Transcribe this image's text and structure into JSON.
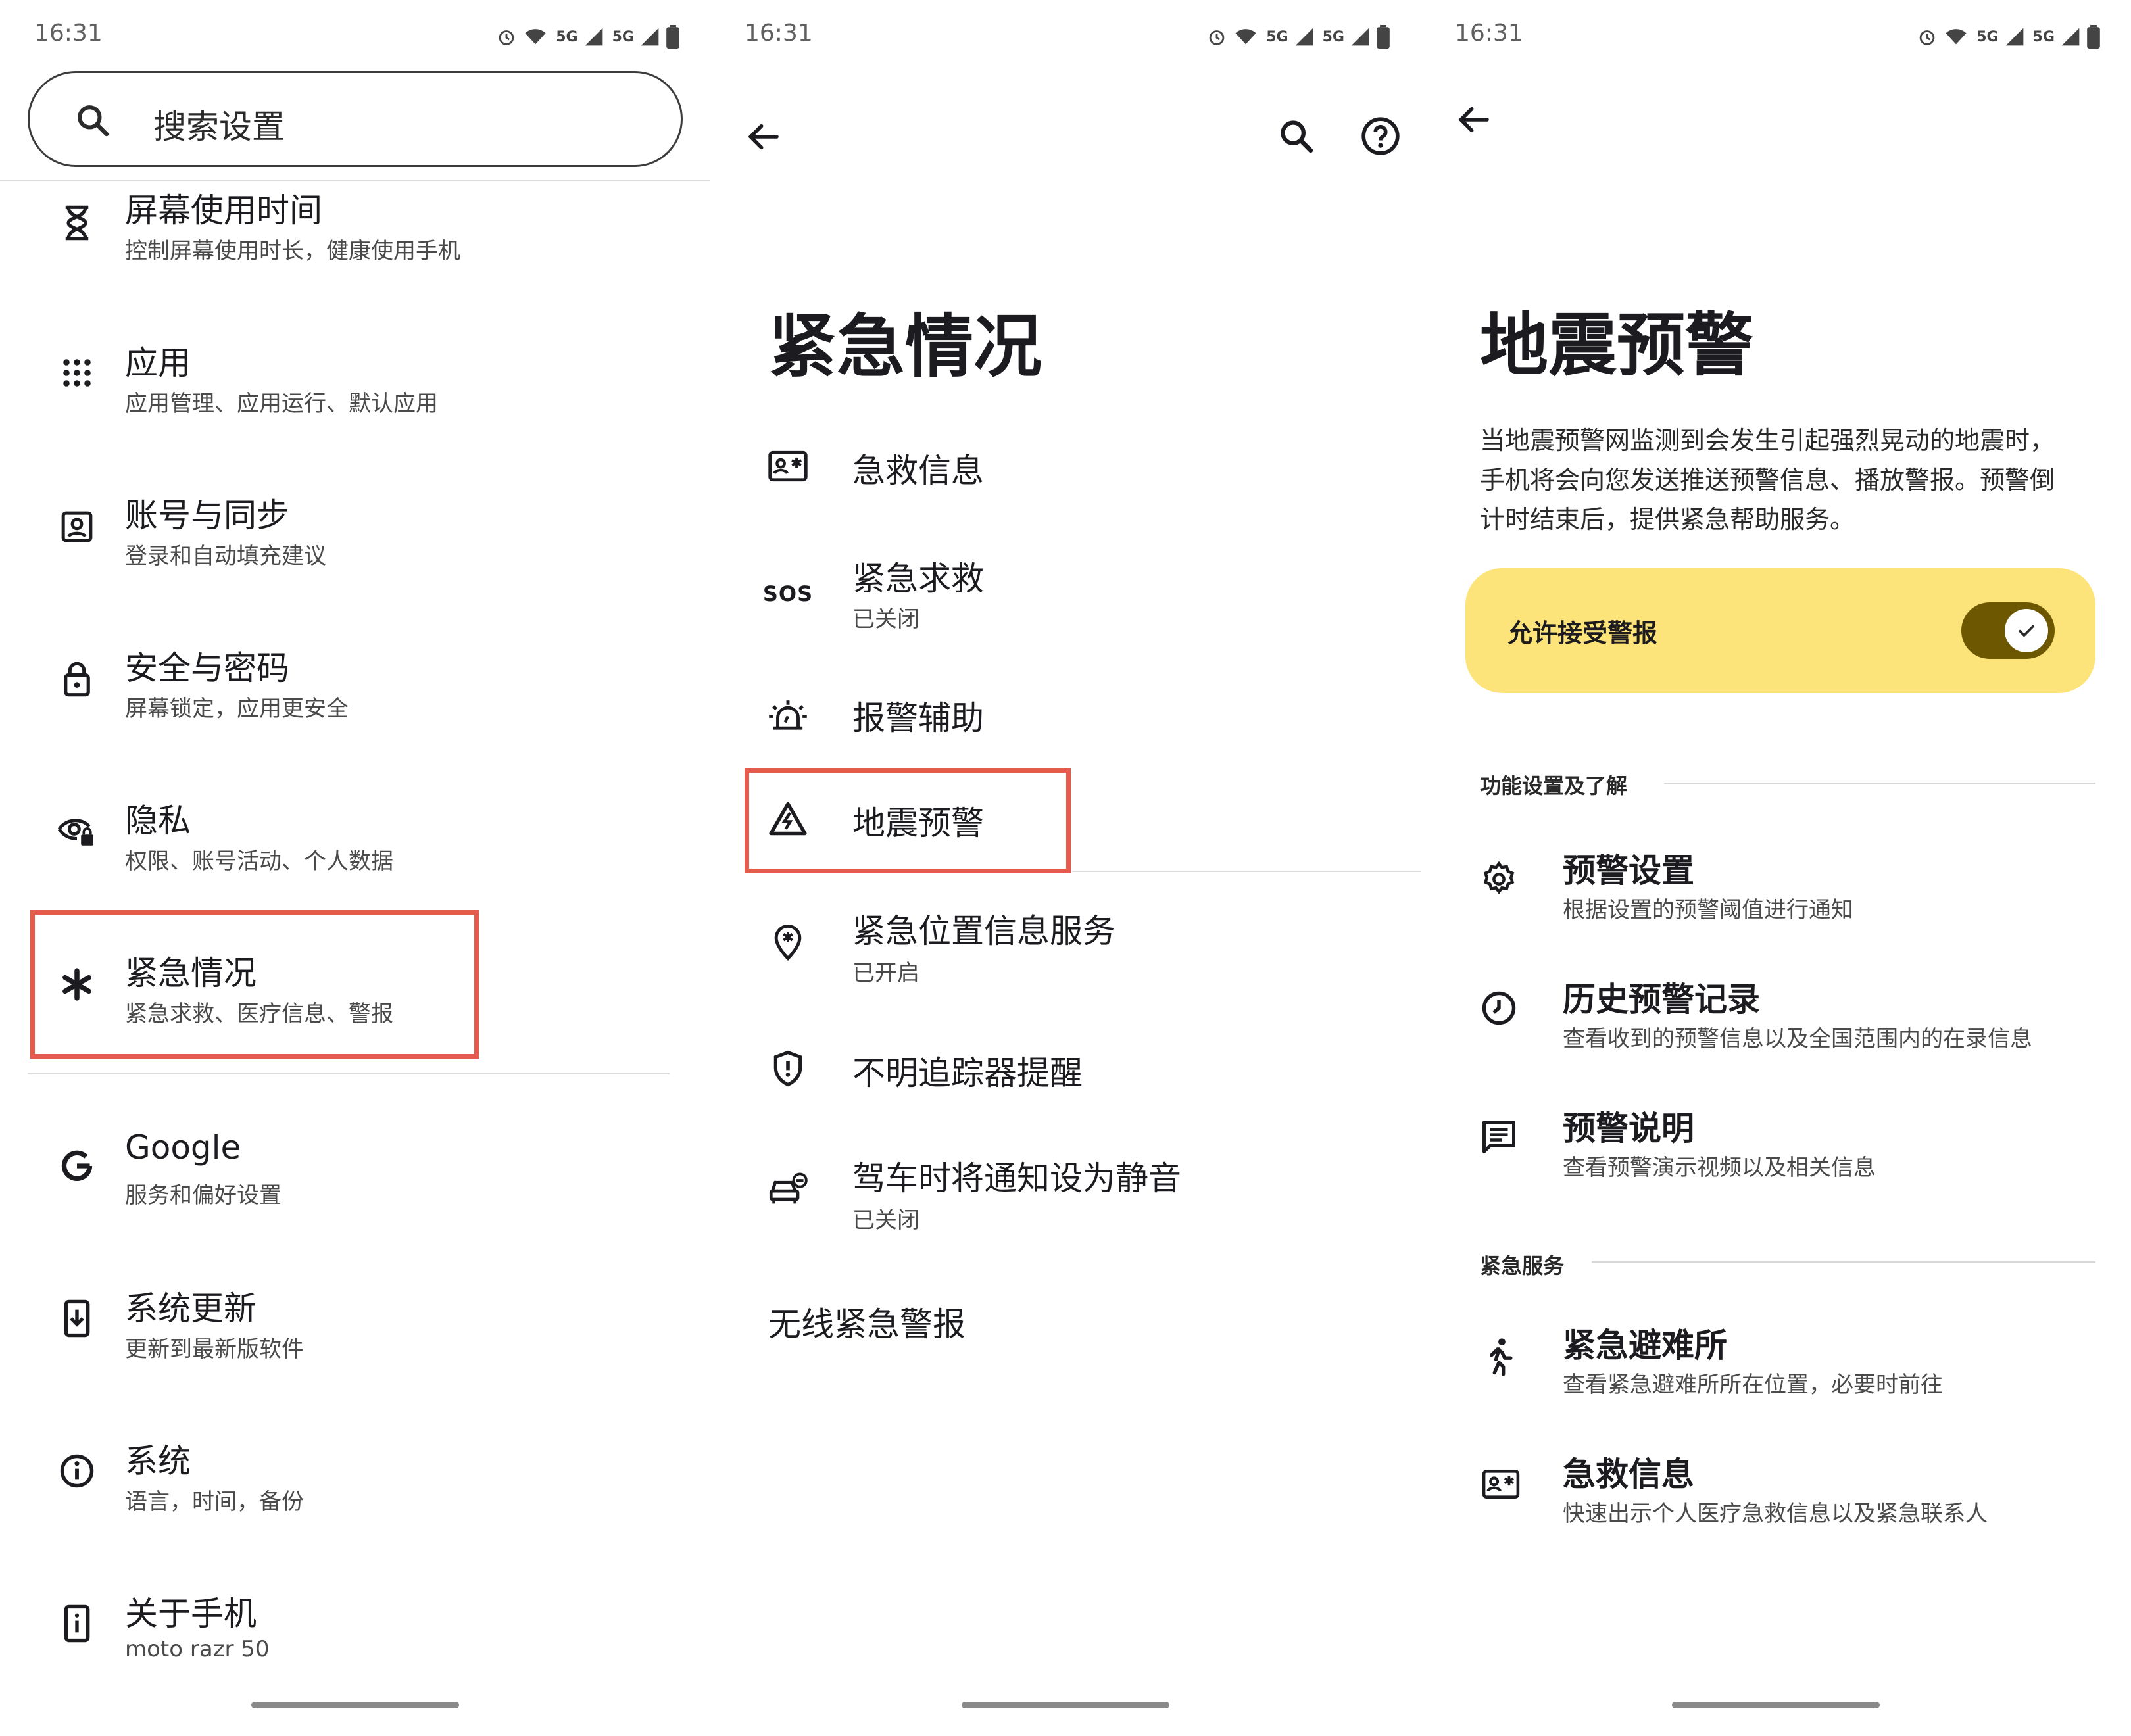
{
  "status_time": "16:31",
  "status_signal": "5G",
  "panel1": {
    "search_placeholder": "搜索设置",
    "items": [
      {
        "title": "屏幕使用时间",
        "sub": "控制屏幕使用时长，健康使用手机",
        "icon": "hourglass-icon"
      },
      {
        "title": "应用",
        "sub": "应用管理、应用运行、默认应用",
        "icon": "apps-grid-icon"
      },
      {
        "title": "账号与同步",
        "sub": "登录和自动填充建议",
        "icon": "account-box-icon"
      },
      {
        "title": "安全与密码",
        "sub": "屏幕锁定，应用更安全",
        "icon": "lock-icon"
      },
      {
        "title": "隐私",
        "sub": "权限、账号活动、个人数据",
        "icon": "privacy-eye-icon"
      },
      {
        "title": "紧急情况",
        "sub": "紧急求救、医疗信息、警报",
        "icon": "asterisk-icon"
      },
      {
        "title": "Google",
        "sub": "服务和偏好设置",
        "icon": "google-icon"
      },
      {
        "title": "系统更新",
        "sub": "更新到最新版软件",
        "icon": "system-update-icon"
      },
      {
        "title": "系统",
        "sub": "语言，时间，备份",
        "icon": "info-icon"
      },
      {
        "title": "关于手机",
        "sub": "moto razr 50",
        "icon": "phone-info-icon"
      }
    ]
  },
  "panel2": {
    "title": "紧急情况",
    "items": [
      {
        "title": "急救信息",
        "sub": "",
        "icon": "medical-id-icon"
      },
      {
        "title": "紧急求救",
        "sub": "已关闭",
        "icon": "sos-icon",
        "icon_text": "SOS"
      },
      {
        "title": "报警辅助",
        "sub": "",
        "icon": "alarm-light-icon"
      },
      {
        "title": "地震预警",
        "sub": "",
        "icon": "earthquake-warning-icon"
      },
      {
        "title": "紧急位置信息服务",
        "sub": "已开启",
        "icon": "location-icon"
      },
      {
        "title": "不明追踪器提醒",
        "sub": "",
        "icon": "shield-icon"
      },
      {
        "title": "驾车时将通知设为静音",
        "sub": "已关闭",
        "icon": "car-mute-icon"
      }
    ],
    "wireless_alerts": "无线紧急警报"
  },
  "panel3": {
    "title": "地震预警",
    "description": "当地震预警网监测到会发生引起强烈晃动的地震时，手机将会向您发送推送预警信息、播放警报。预警倒计时结束后，提供紧急帮助服务。",
    "toggle_label": "允许接受警报",
    "toggle_on": true,
    "section1": "功能设置及了解",
    "items1": [
      {
        "title": "预警设置",
        "sub": "根据设置的预警阈值进行通知",
        "icon": "gear-icon"
      },
      {
        "title": "历史预警记录",
        "sub": "查看收到的预警信息以及全国范围内的在录信息",
        "icon": "clock-icon"
      },
      {
        "title": "预警说明",
        "sub": "查看预警演示视频以及相关信息",
        "icon": "message-icon"
      }
    ],
    "section2": "紧急服务",
    "items2": [
      {
        "title": "紧急避难所",
        "sub": "查看紧急避难所所在位置，必要时前往",
        "icon": "running-person-icon"
      },
      {
        "title": "急救信息",
        "sub": "快速出示个人医疗急救信息以及紧急联系人",
        "icon": "medical-id-icon"
      }
    ]
  },
  "colors": {
    "highlight_border": "#e55b4d",
    "toggle_card": "#fde47a",
    "toggle_track": "#6d5700"
  }
}
